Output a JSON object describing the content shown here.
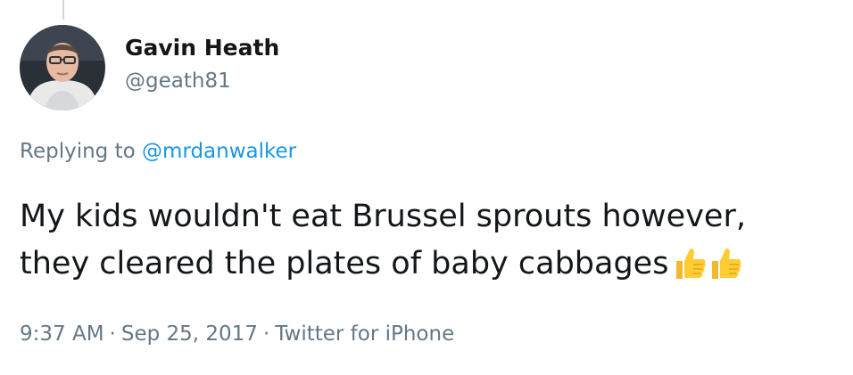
{
  "tweet": {
    "author": {
      "display_name": "Gavin Heath",
      "handle": "@geath81",
      "avatar_icon": "user-photo-avatar"
    },
    "reply_context": {
      "prefix": "Replying to",
      "mention": "@mrdanwalker"
    },
    "text": {
      "line1": "My kids wouldn't eat Brussel sprouts however,",
      "line2": "they cleared the plates of baby cabbages",
      "emojis": [
        "thumbs-up-icon",
        "thumbs-up-icon"
      ]
    },
    "meta": {
      "time": "9:37 AM",
      "separator": "·",
      "date": "Sep 25, 2017",
      "source": "Twitter for iPhone"
    }
  },
  "colors": {
    "text_primary": "#14171a",
    "text_secondary": "#657786",
    "link": "#1b95e0",
    "emoji_yellow": "#ffcc33",
    "thread_line": "#cfd5da"
  }
}
